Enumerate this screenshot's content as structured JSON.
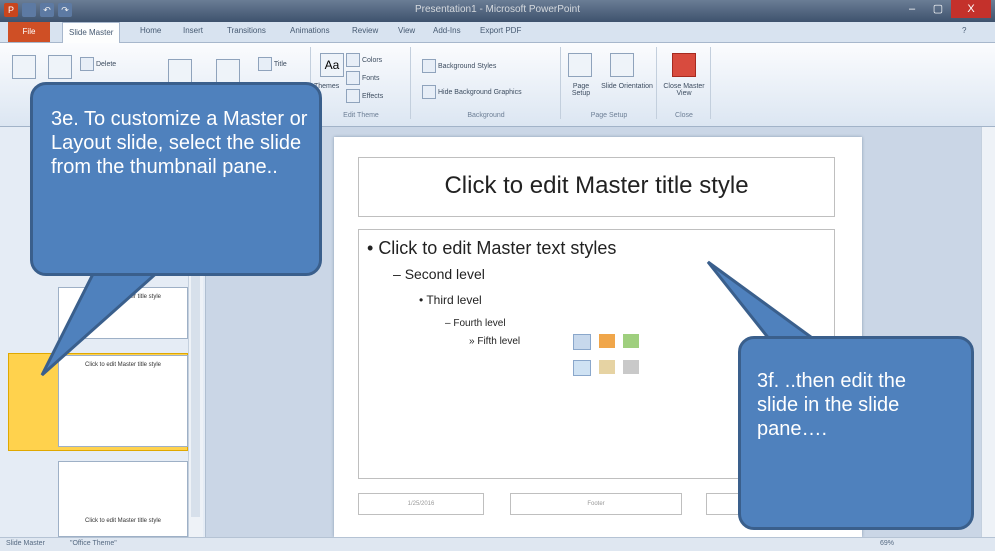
{
  "window": {
    "title": "Presentation1 - Microsoft PowerPoint",
    "controls": {
      "minimize": "–",
      "restore": "▢",
      "close": "X"
    }
  },
  "ribbon": {
    "tabs": [
      "File",
      "Slide Master",
      "Home",
      "Insert",
      "Transitions",
      "Animations",
      "Review",
      "View",
      "Add-Ins",
      "Export PDF"
    ],
    "active_tab": "Slide Master",
    "buttons": {
      "delete": "Delete",
      "title": "Title",
      "themes": "Themes",
      "colors": "Colors",
      "fonts": "Fonts",
      "effects": "Effects",
      "background_styles": "Background Styles",
      "hide_bg_graphics": "Hide Background Graphics",
      "page_setup": "Page Setup",
      "slide_orientation": "Slide Orientation",
      "close_master": "Close Master View"
    },
    "groups": {
      "edit_theme": "Edit Theme",
      "background": "Background",
      "page_setup": "Page Setup",
      "close": "Close"
    }
  },
  "thumbnails": [
    {
      "num": "",
      "text": ""
    },
    {
      "num": "",
      "text": "Click to edit Master title style"
    },
    {
      "num": "",
      "text": "Click to edit Master title style"
    },
    {
      "num": "",
      "text": "Click to edit Master title style"
    }
  ],
  "slide": {
    "title": "Click to edit Master title style",
    "levels": [
      "Click to edit Master text styles",
      "Second level",
      "Third level",
      "Fourth level",
      "Fifth level"
    ],
    "footer": {
      "date": "1/25/2016",
      "footer": "Footer"
    }
  },
  "status": {
    "view": "Slide Master",
    "theme": "\"Office Theme\"",
    "zoom": "69%"
  },
  "callouts": {
    "left": "3e. To customize a Master or Layout slide, select the slide from the thumbnail pane..",
    "right": "3f. ..then edit the slide in the slide pane…."
  },
  "colors": {
    "callout_fill": "#4f81bd",
    "selected_thumb": "#ffd24d"
  }
}
